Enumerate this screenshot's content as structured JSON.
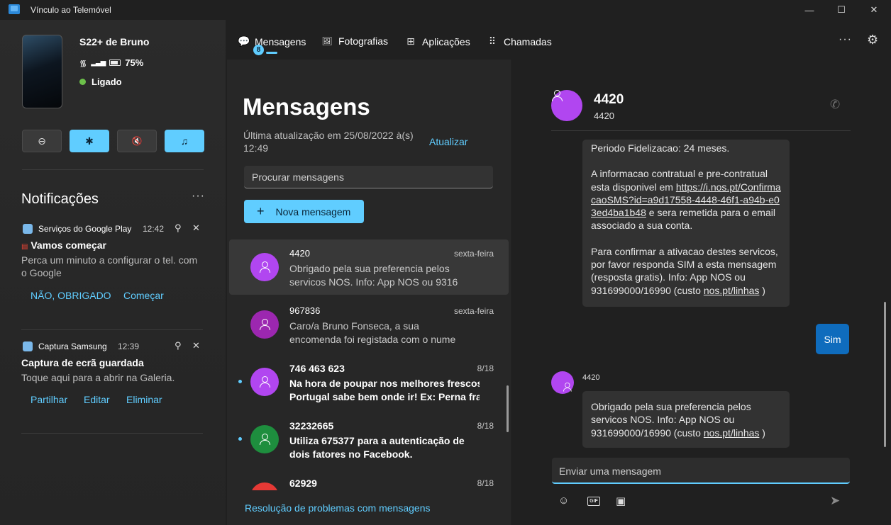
{
  "window": {
    "title": "Vínculo ao Telemóvel",
    "minimize": "—",
    "maximize": "☐",
    "close": "✕"
  },
  "device": {
    "name": "S22+ de Bruno",
    "battery": "75%",
    "connection": "Ligado",
    "quick_actions": [
      {
        "icon": "⊖",
        "name": "do-not-disturb",
        "active": false
      },
      {
        "icon": "✱",
        "name": "bluetooth",
        "active": true
      },
      {
        "icon": "🔇",
        "name": "mute-audio",
        "active": false
      },
      {
        "icon": "♫",
        "name": "media-player",
        "active": true
      }
    ]
  },
  "notifications": {
    "title": "Notificações",
    "more": "···",
    "items": [
      {
        "app": "Serviços do Google Play",
        "time": "12:42",
        "heading": "Vamos começar",
        "body": "Perca um minuto a configurar o tel. com o Google",
        "actions": [
          "NÃO, OBRIGADO",
          "Começar"
        ]
      },
      {
        "app": "Captura Samsung",
        "time": "12:39",
        "heading": "Captura de ecrã guardada",
        "body": "Toque aqui para a abrir na Galeria.",
        "actions": [
          "Partilhar",
          "Editar",
          "Eliminar"
        ]
      }
    ]
  },
  "tabs": {
    "items": [
      {
        "label": "Mensagens",
        "icon": "💬",
        "badge": "8"
      },
      {
        "label": "Fotografias",
        "icon": "🖼"
      },
      {
        "label": "Aplicações",
        "icon": "⊞"
      },
      {
        "label": "Chamadas",
        "icon": "⠿"
      }
    ],
    "more": "···",
    "settings": "⚙"
  },
  "messages": {
    "title": "Mensagens",
    "updated": "Última atualização em 25/08/2022 à(s) 12:49",
    "refresh": "Atualizar",
    "search_placeholder": "Procurar mensagens",
    "new_message": "Nova mensagem",
    "new_message_icon": "+",
    "troubleshoot": "Resolução de problemas com mensagens",
    "conversations": [
      {
        "name": "4420",
        "date": "sexta-feira",
        "line1": "Obrigado pela sua preferencia pelos",
        "line2": "servicos NOS. Info: App NOS ou 9316",
        "avatar_color": "#b146f0",
        "unread": false,
        "selected": true
      },
      {
        "name": "967836",
        "date": "sexta-feira",
        "line1": "Caro/a Bruno Fonseca, a sua",
        "line2": "encomenda foi registada com o nume",
        "avatar_color": "#9c27b0",
        "unread": false,
        "selected": false
      },
      {
        "name": "746 463 623",
        "date": "8/18",
        "line1": "Na hora de poupar nos melhores frescos",
        "line2": "Portugal sabe bem onde ir! Ex: Perna fran",
        "avatar_color": "#b146f0",
        "unread": true,
        "selected": false
      },
      {
        "name": "32232665",
        "date": "8/18",
        "line1": "Utiliza 675377 para a autenticação de",
        "line2": "dois fatores no Facebook.",
        "avatar_color": "#1e8e3e",
        "unread": true,
        "selected": false
      },
      {
        "name": "62929",
        "date": "8/18",
        "line1": "",
        "line2": "",
        "avatar_color": "#e53935",
        "unread": false,
        "selected": false
      }
    ]
  },
  "conversation": {
    "name": "4420",
    "sub": "4420",
    "call_icon": "✆",
    "msg1": {
      "p1": "Periodo Fidelizacao: 24 meses.",
      "p2_a": "A informacao contratual e pre-contratual esta disponivel em ",
      "p2_link": "https://i.nos.pt/ConfirmacaoSMS?id=a9d17558-4448-46f1-a94b-e03ed4ba1b48",
      "p2_b": " e sera remetida para o email associado a sua conta.",
      "p3_a": "Para confirmar a ativacao destes servicos, por favor responda SIM a esta mensagem (resposta gratis). Info: App NOS ou 931699000/16990 (custo ",
      "p3_link": "nos.pt/linhas",
      "p3_b": " )"
    },
    "sent": "Sim",
    "sender": "4420",
    "msg2": {
      "a": "Obrigado pela sua preferencia pelos servicos NOS. Info: App NOS ou 931699000/16990 (custo ",
      "link": "nos.pt/linhas",
      "b": " )"
    },
    "compose_placeholder": "Enviar uma mensagem",
    "emoji_icon": "☺",
    "gif_label": "GIF",
    "image_icon": "▣",
    "send_icon": "➤"
  }
}
